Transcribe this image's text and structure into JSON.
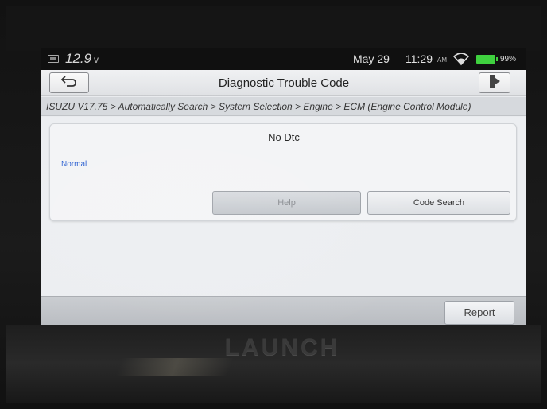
{
  "device": {
    "brand": "LAUNCH"
  },
  "statusbar": {
    "voltage": "12.9",
    "voltage_unit": "v",
    "date": "May 29",
    "time": "11:29",
    "ampm": "AM",
    "battery_percent": "99%",
    "icons": [
      "battery-icon",
      "wifi-icon",
      "battery-level-icon"
    ]
  },
  "titlebar": {
    "title": "Diagnostic Trouble Code",
    "back_icon": "back-arrow-icon",
    "exit_icon": "exit-icon"
  },
  "breadcrumb": {
    "text": "ISUZU V17.75 > Automatically Search > System Selection > Engine > ECM (Engine Control Module)"
  },
  "card": {
    "title": "No Dtc",
    "status": "Normal",
    "help_label": "Help",
    "code_search_label": "Code Search"
  },
  "bottombar": {
    "report_label": "Report"
  },
  "colors": {
    "status_text": "#2a5fd0",
    "battery_green": "#3fd13f",
    "screen_bg": "#e9ebee"
  }
}
